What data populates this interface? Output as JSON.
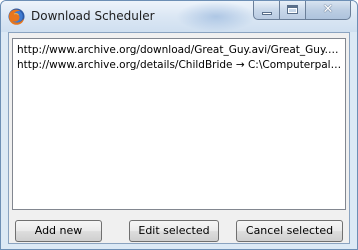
{
  "window": {
    "title": "Download Scheduler",
    "icon": "firefox-icon",
    "controls": {
      "minimize": "minimize-icon",
      "maximize": "maximize-icon",
      "close": "close-icon"
    }
  },
  "list": {
    "items": [
      {
        "text": "http://www.archive.org/download/Great_Guy.avi/Great_Guy.av..."
      },
      {
        "text": "http://www.archive.org/details/ChildBride → C:\\Computerpals\\..."
      }
    ]
  },
  "buttons": {
    "add": "Add new",
    "edit": "Edit selected",
    "cancel": "Cancel selected"
  }
}
